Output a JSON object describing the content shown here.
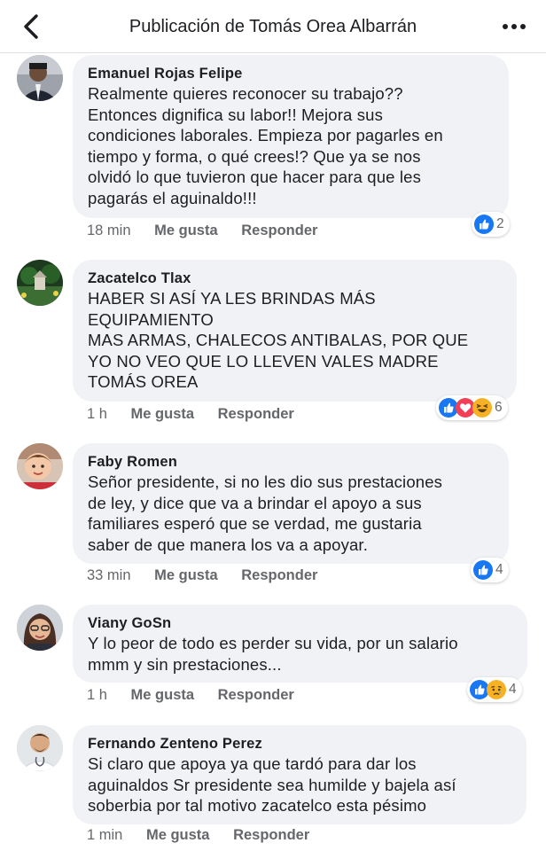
{
  "header": {
    "title": "Publicación de Tomás Orea Albarrán"
  },
  "comments": [
    {
      "author": "Emanuel Rojas Felipe",
      "text": "Realmente quieres reconocer su trabajo??\nEntonces dignifica su labor!! Mejora sus\ncondiciones laborales. Empieza por pagarles en\ntiempo y forma, o qué crees!? Que ya se nos\nolvidó lo que tuvieron que hacer para que les\npagarás el aguinaldo!!!",
      "time": "18 min",
      "like_label": "Me gusta",
      "reply_label": "Responder",
      "reaction_count": "2",
      "reactions": [
        "like-icon"
      ]
    },
    {
      "author": "Zacatelco Tlax",
      "text": "HABER SI ASÍ YA LES BRINDAS MÁS\nEQUIPAMIENTO\nMAS ARMAS, CHALECOS ANTIBALAS, POR QUE\nYO NO VEO QUE LO LLEVEN VALES MADRE\nTOMÁS OREA",
      "time": "1 h",
      "like_label": "Me gusta",
      "reply_label": "Responder",
      "reaction_count": "6",
      "reactions": [
        "like-icon",
        "love-icon",
        "haha-icon"
      ]
    },
    {
      "author": "Faby Romen",
      "text": "Señor presidente, si no les dio sus prestaciones\nde ley, y dice que va a brindar el apoyo a sus\nfamiliares esperó que se verdad, me gustaria\nsaber de que manera los va a apoyar.",
      "time": "33 min",
      "like_label": "Me gusta",
      "reply_label": "Responder",
      "reaction_count": "4",
      "reactions": [
        "like-icon"
      ]
    },
    {
      "author": "Viany GoSn",
      "text": "Y lo peor de todo es perder su vida, por un salario\nmmm y sin prestaciones...",
      "time": "1 h",
      "like_label": "Me gusta",
      "reply_label": "Responder",
      "reaction_count": "4",
      "reactions": [
        "like-icon",
        "sad-icon"
      ]
    },
    {
      "author": "Fernando Zenteno Perez",
      "text": "Si claro que apoya ya que tardó para dar los\naguinaldos Sr  presidente sea humilde y bajela así\nsoberbia por  tal motivo zacatelco esta pésimo",
      "time": "1 min",
      "like_label": "Me gusta",
      "reply_label": "Responder",
      "reaction_count": "",
      "reactions": []
    }
  ],
  "colors": {
    "bubble": "#f0f2f5",
    "meta_text": "#65676b",
    "like_blue": "#1877f2",
    "love_red": "#f33e58",
    "haha_yellow": "#f7b125"
  }
}
